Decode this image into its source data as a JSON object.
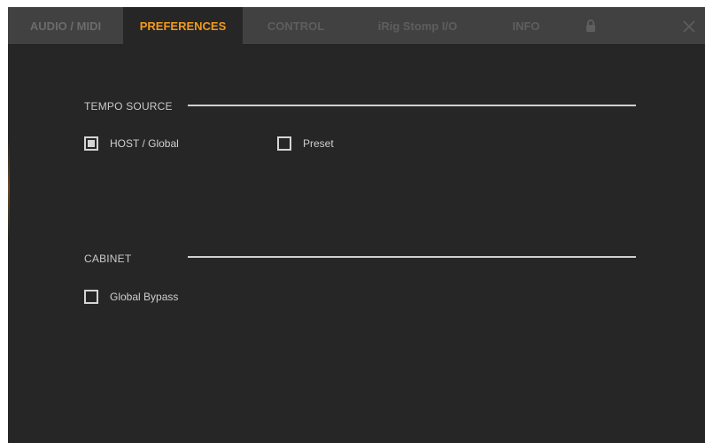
{
  "tabs": [
    {
      "label": "AUDIO / MIDI",
      "active": false
    },
    {
      "label": "PREFERENCES",
      "active": true
    },
    {
      "label": "CONTROL",
      "active": false
    },
    {
      "label": "iRig Stomp I/O",
      "active": false
    },
    {
      "label": "INFO",
      "active": false
    }
  ],
  "icons": {
    "lock": "lock-icon",
    "close": "close-icon"
  },
  "colors": {
    "accent": "#f39a1c",
    "background": "#262626",
    "tabbar": "#414141"
  },
  "tempo_source": {
    "title": "TEMPO SOURCE",
    "options": [
      {
        "label": "HOST / Global",
        "checked": true
      },
      {
        "label": "Preset",
        "checked": false
      }
    ]
  },
  "cabinet": {
    "title": "CABINET",
    "options": [
      {
        "label": "Global Bypass",
        "checked": false
      }
    ]
  }
}
